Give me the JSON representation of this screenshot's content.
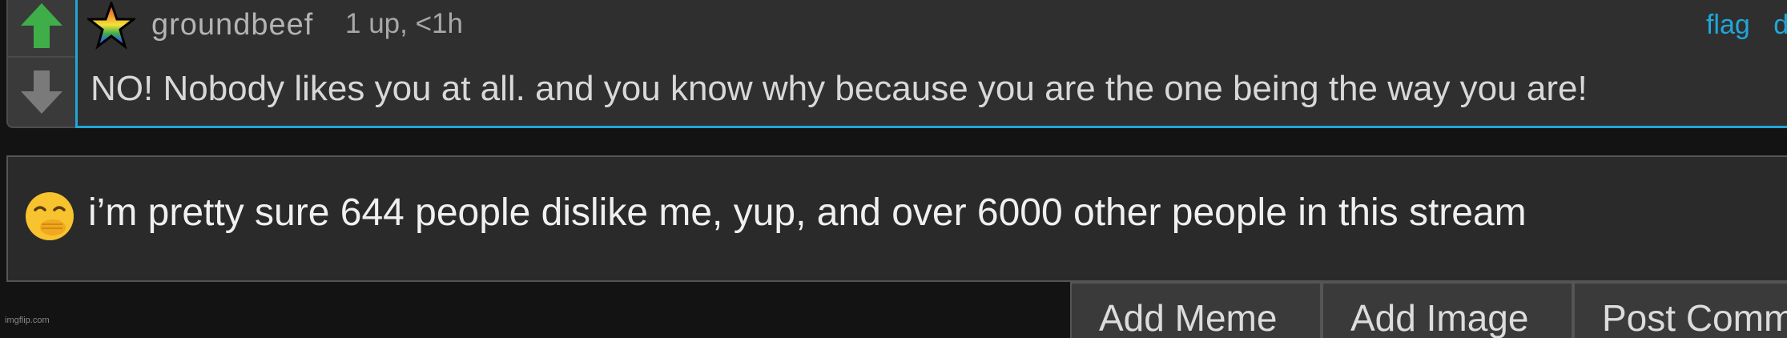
{
  "comment": {
    "username": "groundbeef",
    "meta": "1 up, <1h",
    "actions": {
      "flag": "flag",
      "delete": "delet"
    },
    "text": "NO! Nobody likes you at all. and you know why because you are the one being the way you are!"
  },
  "reply_input": {
    "value": "i’m pretty sure 644 people dislike me, yup, and over 6000 other people in this stream",
    "emoji_icon": "face-with-hand-over-mouth-icon"
  },
  "buttons": {
    "add_meme": "Add Meme",
    "add_image": "Add Image",
    "post_comment": "Post Comm"
  },
  "watermark": "imgflip.com",
  "colors": {
    "upvote": "#3fae49",
    "downvote": "#7a7a7a",
    "accent": "#1fa7d8"
  }
}
